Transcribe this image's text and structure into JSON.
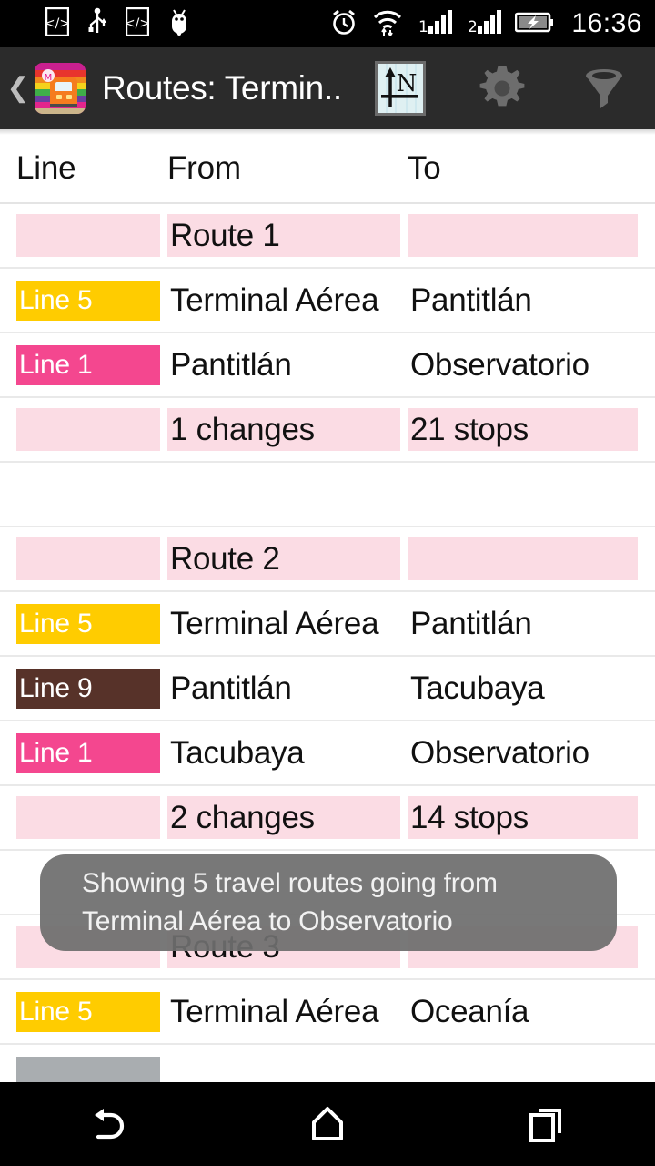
{
  "statusbar": {
    "time": "16:36",
    "icons": [
      "code-brackets-icon",
      "usb-icon",
      "code-brackets-icon",
      "android-bug-icon",
      "alarm-clock-icon",
      "wifi-icon",
      "signal-bars-1-icon",
      "signal-bars-2-icon",
      "battery-charging-icon"
    ]
  },
  "appbar": {
    "back_label": "❮",
    "app_icon_name": "metro-train-app-icon",
    "title": "Routes: Termin..",
    "actions": [
      {
        "name": "north-arrow-icon",
        "label": "N"
      },
      {
        "name": "gear-icon",
        "label": ""
      },
      {
        "name": "filter-funnel-icon",
        "label": ""
      }
    ]
  },
  "table": {
    "headers": [
      "Line",
      "From",
      "To"
    ],
    "rows": [
      {
        "type": "route-title",
        "line": "",
        "from": "Route 1",
        "to": ""
      },
      {
        "type": "leg",
        "line": "Line 5",
        "line_color": "#ffcc00",
        "from": "Terminal Aérea",
        "to": "Pantitlán"
      },
      {
        "type": "leg",
        "line": "Line 1",
        "line_color": "#f4478f",
        "from": "Pantitlán",
        "to": "Observatorio"
      },
      {
        "type": "summary",
        "line": "",
        "from": "1 changes",
        "to": "21 stops"
      },
      {
        "type": "spacer",
        "line": "",
        "from": "",
        "to": ""
      },
      {
        "type": "route-title",
        "line": "",
        "from": "Route 2",
        "to": ""
      },
      {
        "type": "leg",
        "line": "Line 5",
        "line_color": "#ffcc00",
        "from": "Terminal Aérea",
        "to": "Pantitlán"
      },
      {
        "type": "leg",
        "line": "Line 9",
        "line_color": "#573229",
        "from": "Pantitlán",
        "to": "Tacubaya"
      },
      {
        "type": "leg",
        "line": "Line 1",
        "line_color": "#f4478f",
        "from": "Tacubaya",
        "to": "Observatorio"
      },
      {
        "type": "summary",
        "line": "",
        "from": "2 changes",
        "to": "14 stops"
      },
      {
        "type": "spacer",
        "line": "",
        "from": "",
        "to": ""
      },
      {
        "type": "route-title",
        "line": "",
        "from": "Route 3",
        "to": ""
      },
      {
        "type": "leg",
        "line": "Line 5",
        "line_color": "#ffcc00",
        "from": "Terminal Aérea",
        "to": "Oceanía"
      },
      {
        "type": "leg-partial",
        "line": "",
        "line_color": "#a9adb0",
        "from": "",
        "to": ""
      }
    ]
  },
  "toast": {
    "line1": "Showing 5 travel routes going from",
    "line2": "Terminal Aérea to Observatorio"
  },
  "navbar": {
    "buttons": [
      {
        "name": "nav-back-button"
      },
      {
        "name": "nav-home-button"
      },
      {
        "name": "nav-recents-button"
      }
    ]
  },
  "colors": {
    "cell_pink": "#fbdce4",
    "appbar_bg": "#2b2b2b",
    "toast_bg": "#6e6e6e",
    "line5": "#ffcc00",
    "line1": "#f4478f",
    "line9": "#573229",
    "line_grey": "#a9adb0"
  }
}
